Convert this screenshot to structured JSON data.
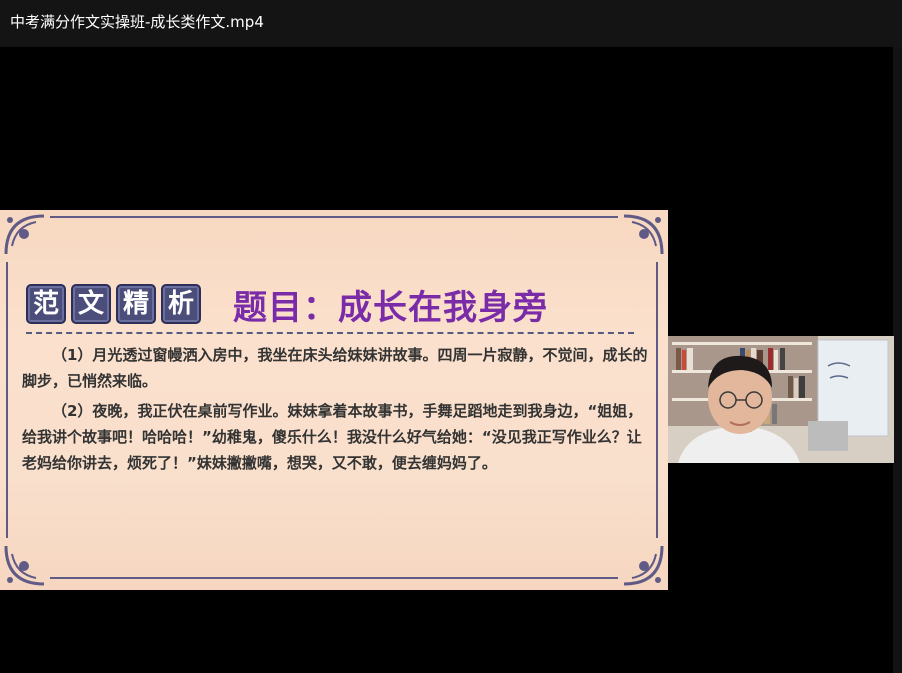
{
  "window": {
    "title": "中考满分作文实操班-成长类作文.mp4"
  },
  "slide": {
    "badges": [
      "范",
      "文",
      "精",
      "析"
    ],
    "title": "题目：成长在我身旁",
    "paragraphs": [
      "（1）月光透过窗幔洒入房中，我坐在床头给妹妹讲故事。四周一片寂静，不觉间，成长的脚步，已悄然来临。",
      "（2）夜晚，我正伏在桌前写作业。妹妹拿着本故事书，手舞足蹈地走到我身边，“姐姐，给我讲个故事吧！哈哈哈！”幼稚鬼，傻乐什么！我没什么好气给她：“没见我正写作业么？让老妈给你讲去，烦死了！”妹妹撇撇嘴，想哭，又不敢，便去缠妈妈了。"
    ]
  },
  "colors": {
    "title_purple": "#7a2ba8",
    "badge_bg": "#4b4e7b",
    "frame": "#5f5a86",
    "slide_bg": "#f9decb"
  }
}
